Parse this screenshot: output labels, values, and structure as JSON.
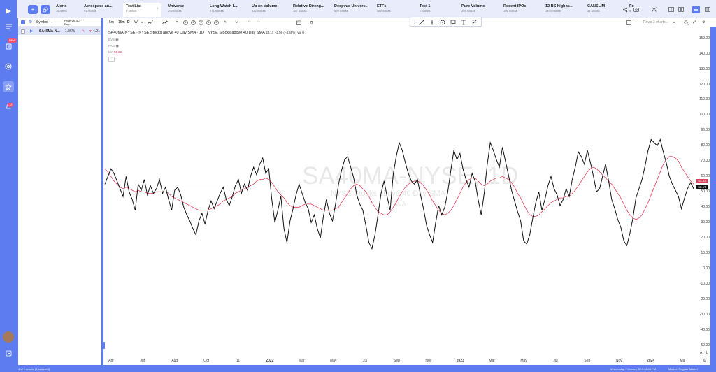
{
  "sidebar": {
    "badges": [
      "NEW",
      "12"
    ]
  },
  "tabs": [
    {
      "title": "Alerts",
      "sub": "16 Alerts"
    },
    {
      "title": "Aerospace an...",
      "sub": "91 Stocks"
    },
    {
      "title": "Test List",
      "sub": "4 Stocks"
    },
    {
      "title": "Universe",
      "sub": "296 Stocks"
    },
    {
      "title": "Long Watch L...",
      "sub": "271 Stocks"
    },
    {
      "title": "Up on Volume",
      "sub": "132 Stocks"
    },
    {
      "title": "Relative Streng...",
      "sub": "157 Stocks"
    },
    {
      "title": "Deepvue Univers...",
      "sub": "570 Stocks"
    },
    {
      "title": "ETFs",
      "sub": "466 Stocks"
    },
    {
      "title": "Test 1",
      "sub": "0 Stocks"
    },
    {
      "title": "Pure Volume",
      "sub": "259 Stocks"
    },
    {
      "title": "Recent IPOs",
      "sub": "196 Stocks"
    },
    {
      "title": "12 RS high w...",
      "sub": "1494 Stocks"
    },
    {
      "title": "CANSLIM",
      "sub": "31 Stocks"
    },
    {
      "title": "Fo",
      "sub": "9"
    }
  ],
  "watchlist": {
    "col_symbol": "Symbol",
    "col_price": "Price Vs. 50 Day...",
    "row": {
      "symbol": "SA40MA-N...",
      "pct": "1.86%",
      "val": "4.91"
    }
  },
  "toolbar": {
    "intervals": [
      "5m",
      "15m",
      "D",
      "W"
    ],
    "circles": [
      "1",
      "2",
      "3",
      "4",
      "5"
    ],
    "rows_label": "Rows 3 charts..."
  },
  "legend": {
    "main": "SA40MA-NYSE · NYSE Stocks above 40 Day SMA · 1D · NYSE Stocks above 40 Day SMA",
    "last": "53.17",
    "chg": "−2.56 (−4.59%)",
    "vol": "vol 0",
    "row2": "EVS",
    "row3": "PAG",
    "ma": "MA",
    "ma_val": "53.83"
  },
  "watermark": {
    "title": "SA40MA-NYSE, 1D",
    "sub": "NYSE Stocks above 40 Day SMA",
    "sub2": "$NA"
  },
  "price_labels": {
    "ma_last": "53.83",
    "last": "53.17"
  },
  "axis_corner": {
    "a": "A",
    "l": "L"
  },
  "status": {
    "left": "1 of 1 results (1 selected)",
    "right": "Wednesday, February 28 3:44:46 PM",
    "market": "Market: Regular Market"
  },
  "colors": {
    "accent": "#5c7cf0",
    "price": "#111111",
    "ma": "#e0405b"
  },
  "chart_data": {
    "type": "line",
    "title": "",
    "ylim": [
      -55,
      153
    ],
    "y_ticks": [
      150,
      140,
      130,
      120,
      110,
      100,
      90,
      80,
      70,
      60,
      50,
      40,
      30,
      20,
      10,
      0,
      -10,
      -20,
      -30,
      -40,
      -50
    ],
    "y_tick_labels": [
      "150.00",
      "140.00",
      "130.00",
      "120.00",
      "110.00",
      "100.00",
      "90.00",
      "80.00",
      "70.00",
      "60.00",
      "50.00",
      "40.00",
      "30.00",
      "20.00",
      "10.00",
      "0.00",
      "-10.00",
      "-20.00",
      "-30.00",
      "-40.00",
      "-50.00"
    ],
    "x_ticks": [
      "Apr",
      "Jun",
      "Aug",
      "Oct",
      "11",
      "2022",
      "Mar",
      "May",
      "Jul",
      "Sep",
      "Nov",
      "2023",
      "Mar",
      "May",
      "Jul",
      "Sep",
      "Nov",
      "2024",
      "Ma"
    ],
    "x_ticks_bold": [
      "2022",
      "2023",
      "2024"
    ],
    "reference_level": 53.17,
    "series": [
      {
        "values": [
          55,
          60,
          65,
          62,
          57,
          52,
          47,
          60,
          50,
          45,
          38,
          55,
          51,
          58,
          48,
          54,
          49,
          52,
          58,
          49,
          53,
          45,
          38,
          51,
          53,
          48,
          40,
          35,
          31,
          26,
          22,
          31,
          36,
          29,
          38,
          44,
          39,
          44,
          49,
          53,
          45,
          41,
          47,
          54,
          58,
          49,
          55,
          51,
          60,
          66,
          61,
          68,
          72,
          62,
          65,
          45,
          30,
          38,
          47,
          26,
          17,
          31,
          39,
          48,
          55,
          49,
          43,
          39,
          30,
          35,
          26,
          20,
          34,
          45,
          36,
          31,
          42,
          55,
          64,
          71,
          73,
          66,
          59,
          48,
          42,
          38,
          28,
          17,
          13,
          22,
          35,
          49,
          57,
          47,
          38,
          61,
          73,
          82,
          77,
          69,
          62,
          57,
          55,
          58,
          48,
          39,
          28,
          22,
          17,
          30,
          41,
          35,
          40,
          50,
          64,
          77,
          71,
          75,
          65,
          58,
          53,
          62,
          57,
          45,
          35,
          49,
          68,
          82,
          77,
          71,
          66,
          79,
          70,
          61,
          51,
          44,
          37,
          31,
          18,
          16,
          22,
          33,
          43,
          50,
          38,
          45,
          54,
          60,
          52,
          48,
          41,
          45,
          52,
          47,
          58,
          66,
          76,
          73,
          68,
          77,
          69,
          60,
          50,
          52,
          60,
          68,
          57,
          45,
          39,
          32,
          27,
          18,
          15,
          23,
          33,
          46,
          52,
          58,
          67,
          77,
          84,
          82,
          80,
          84,
          76,
          69,
          60,
          55,
          51,
          47,
          39,
          46,
          52,
          56,
          52
        ]
      },
      {
        "values": [
          65,
          63,
          60,
          57,
          55,
          53,
          52,
          53,
          52,
          51,
          50,
          51,
          50,
          50,
          49,
          49,
          49,
          50,
          50,
          50,
          50,
          49,
          47,
          46,
          45,
          44,
          43,
          42,
          41,
          40,
          39,
          38,
          38,
          38,
          38,
          39,
          40,
          41,
          42,
          44,
          45,
          46,
          47,
          49,
          50,
          51,
          52,
          53,
          54,
          55,
          57,
          58,
          58,
          59,
          58,
          56,
          53,
          50,
          48,
          46,
          43,
          41,
          40,
          40,
          40,
          41,
          42,
          42,
          42,
          41,
          40,
          39,
          38,
          38,
          38,
          38,
          39,
          40,
          43,
          46,
          49,
          52,
          54,
          55,
          54,
          52,
          50,
          47,
          43,
          40,
          37,
          36,
          35,
          35,
          37,
          40,
          43,
          47,
          50,
          53,
          55,
          56,
          57,
          57,
          56,
          54,
          51,
          48,
          44,
          41,
          38,
          36,
          35,
          36,
          38,
          41,
          45,
          49,
          53,
          56,
          58,
          59,
          59,
          57,
          55,
          54,
          55,
          57,
          58,
          59,
          59,
          60,
          59,
          58,
          56,
          53,
          49,
          46,
          42,
          38,
          35,
          34,
          34,
          35,
          37,
          39,
          41,
          43,
          44,
          45,
          46,
          46,
          47,
          47,
          49,
          51,
          54,
          57,
          60,
          63,
          65,
          66,
          65,
          63,
          61,
          59,
          57,
          55,
          52,
          49,
          46,
          42,
          38,
          35,
          33,
          32,
          33,
          35,
          39,
          43,
          48,
          53,
          58,
          63,
          68,
          71,
          73,
          73,
          72,
          70,
          66,
          63,
          60,
          57,
          55
        ]
      }
    ]
  }
}
